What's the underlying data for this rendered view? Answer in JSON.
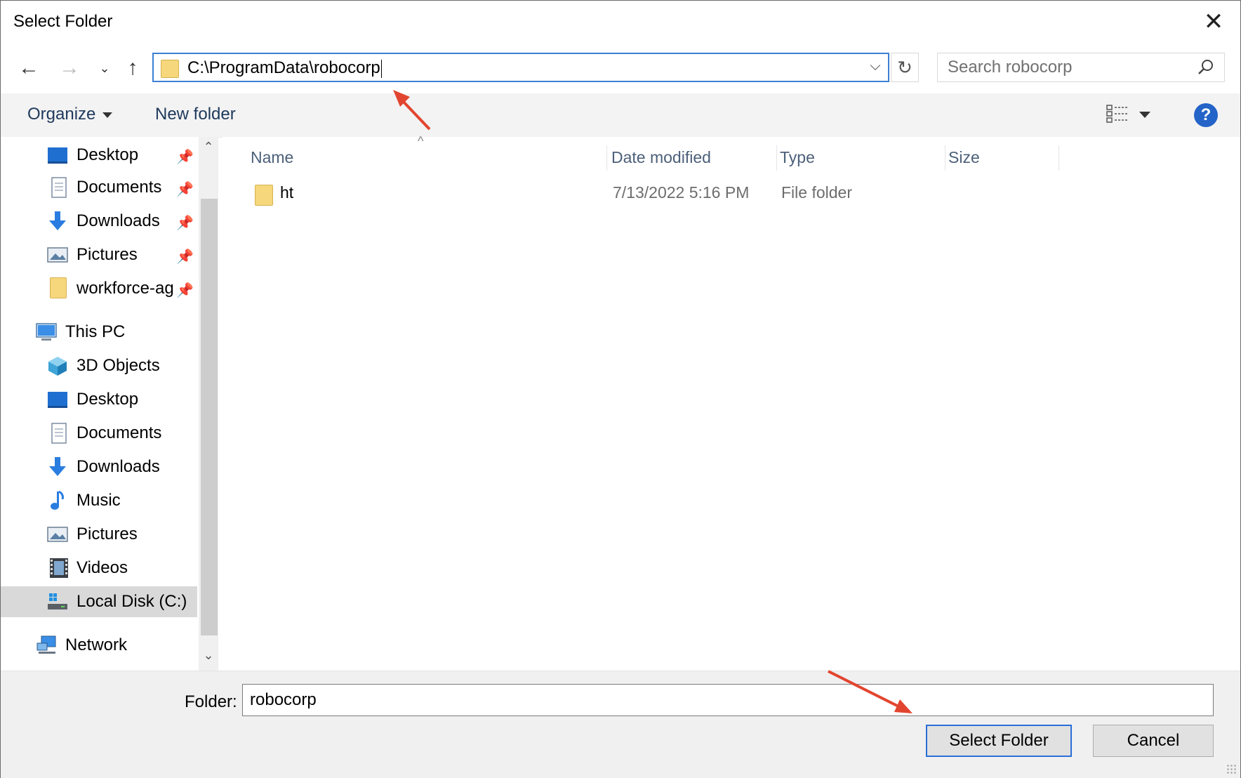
{
  "window": {
    "title": "Select Folder",
    "close_icon": "close-icon"
  },
  "navigation": {
    "back_icon": "back-arrow-icon",
    "forward_icon": "forward-arrow-icon",
    "recent_icon": "chevron-down-icon",
    "up_icon": "up-arrow-icon",
    "address_path": "C:\\ProgramData\\robocorp",
    "refresh_icon": "refresh-icon",
    "search_placeholder": "Search robocorp"
  },
  "toolbar": {
    "organize_label": "Organize",
    "new_folder_label": "New folder",
    "help_label": "?"
  },
  "nav_pane": {
    "quick_access": [
      {
        "label": "Desktop",
        "icon": "desktop-icon",
        "pinned": true
      },
      {
        "label": "Documents",
        "icon": "documents-icon",
        "pinned": true
      },
      {
        "label": "Downloads",
        "icon": "downloads-icon",
        "pinned": true
      },
      {
        "label": "Pictures",
        "icon": "pictures-icon",
        "pinned": true
      },
      {
        "label": "workforce-ag",
        "icon": "folder-icon",
        "pinned": true
      }
    ],
    "this_pc": {
      "label": "This PC",
      "items": [
        {
          "label": "3D Objects",
          "icon": "3d-objects-icon"
        },
        {
          "label": "Desktop",
          "icon": "desktop-icon"
        },
        {
          "label": "Documents",
          "icon": "documents-icon"
        },
        {
          "label": "Downloads",
          "icon": "downloads-icon"
        },
        {
          "label": "Music",
          "icon": "music-icon"
        },
        {
          "label": "Pictures",
          "icon": "pictures-icon"
        },
        {
          "label": "Videos",
          "icon": "videos-icon"
        },
        {
          "label": "Local Disk (C:)",
          "icon": "local-disk-icon",
          "selected": true
        }
      ]
    },
    "network": {
      "label": "Network",
      "icon": "network-icon"
    }
  },
  "file_list": {
    "columns": [
      "Name",
      "Date modified",
      "Type",
      "Size"
    ],
    "rows": [
      {
        "name": "ht",
        "date_modified": "7/13/2022 5:16 PM",
        "type": "File folder",
        "size": ""
      }
    ]
  },
  "footer": {
    "folder_label": "Folder:",
    "folder_value": "robocorp",
    "select_button": "Select Folder",
    "cancel_button": "Cancel"
  },
  "colors": {
    "accent_blue": "#2a6fd6",
    "annotation_red": "#e2452f",
    "folder_yellow": "#f6d77c"
  }
}
